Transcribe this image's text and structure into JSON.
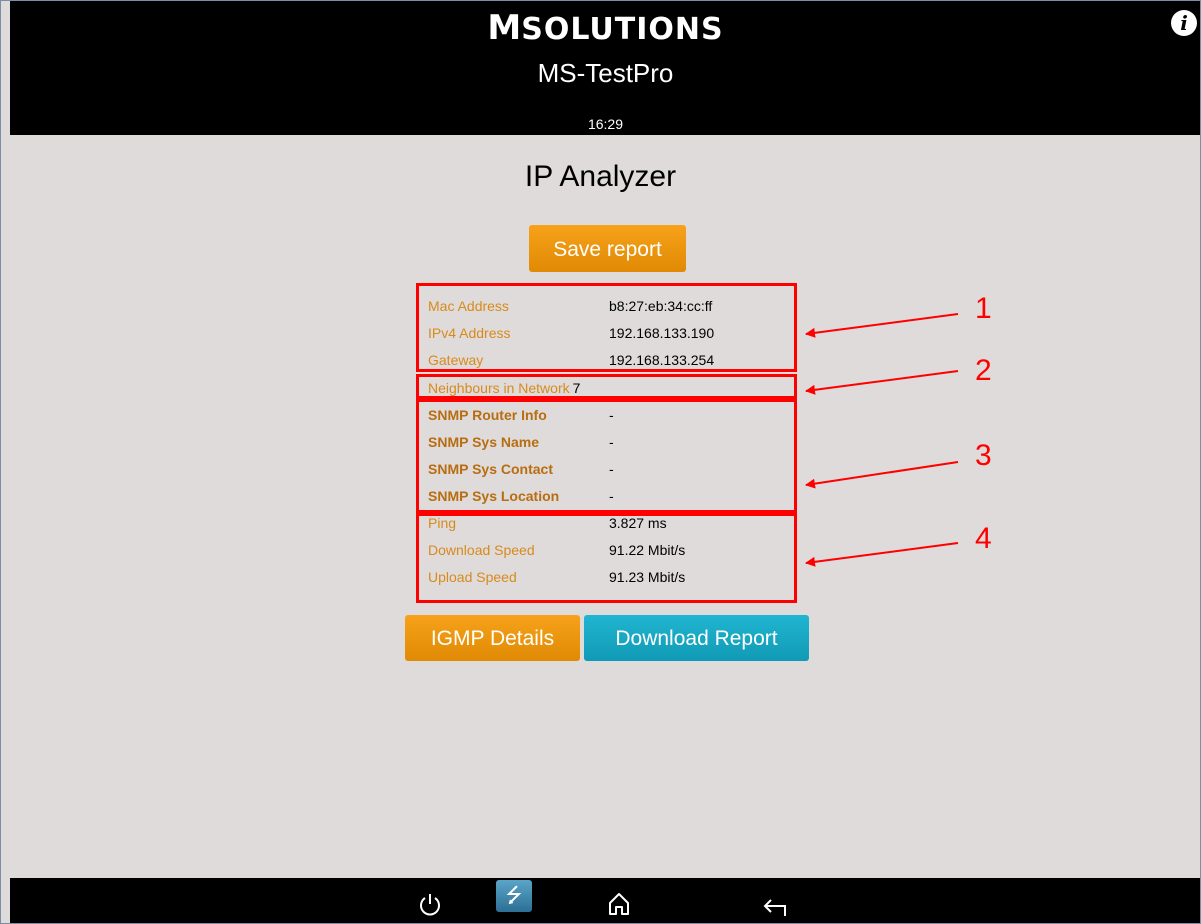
{
  "header": {
    "brand_mark": "M",
    "brand_text": "SOLUTIONS",
    "device_name": "MS-TestPro",
    "time": "16:29",
    "info_glyph": "i"
  },
  "page": {
    "title": "IP Analyzer",
    "save_button": "Save report",
    "igmp_button": "IGMP Details",
    "download_button": "Download Report"
  },
  "sections": {
    "network": [
      {
        "label": "Mac Address",
        "value": "b8:27:eb:34:cc:ff"
      },
      {
        "label": "IPv4 Address",
        "value": "192.168.133.190"
      },
      {
        "label": "Gateway",
        "value": "192.168.133.254"
      }
    ],
    "neighbours": {
      "label": "Neighbours in Network",
      "value": "7"
    },
    "snmp": [
      {
        "label": "SNMP Router Info",
        "value": "-"
      },
      {
        "label": "SNMP Sys Name",
        "value": "-"
      },
      {
        "label": "SNMP Sys Contact",
        "value": "-"
      },
      {
        "label": "SNMP Sys Location",
        "value": "-"
      }
    ],
    "speed": [
      {
        "label": "Ping",
        "value": "3.827 ms"
      },
      {
        "label": "Download Speed",
        "value": "91.22 Mbit/s"
      },
      {
        "label": "Upload Speed",
        "value": "91.23 Mbit/s"
      }
    ]
  },
  "callouts": [
    "1",
    "2",
    "3",
    "4"
  ],
  "footer": {
    "icons": [
      "power-icon",
      "usb-icon",
      "home-icon",
      "back-icon"
    ]
  },
  "colors": {
    "background": "#dedbda",
    "header": "#000000",
    "label": "#d98a1c",
    "accent_orange": "#f39c12",
    "accent_teal": "#17a8c4",
    "annotation": "#ff0000"
  }
}
